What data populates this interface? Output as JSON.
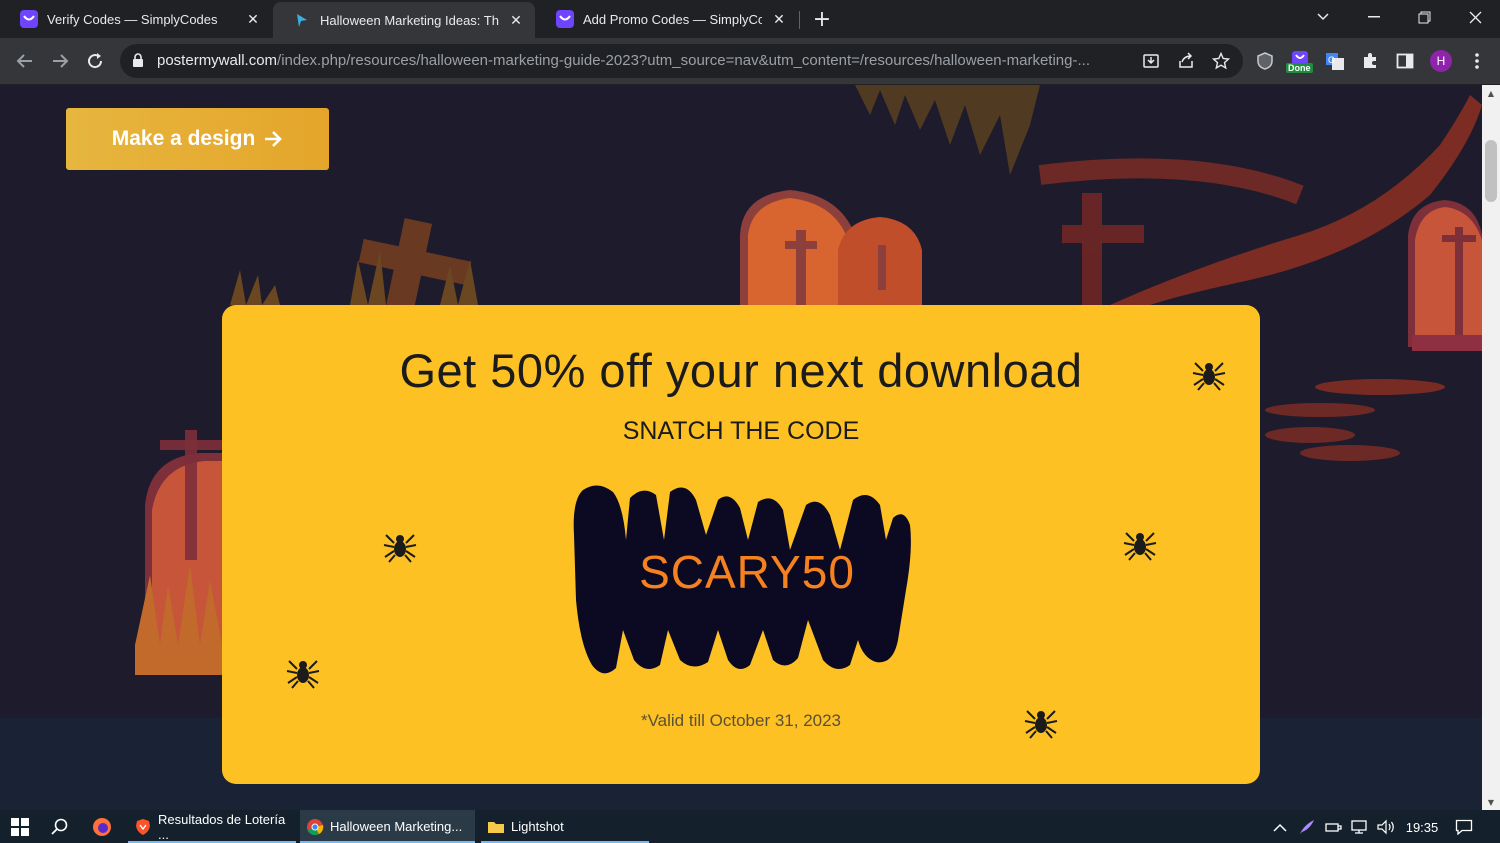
{
  "browser": {
    "tabs": [
      {
        "title": "Verify Codes — SimplyCodes",
        "active": false,
        "icon": "simplycodes-icon"
      },
      {
        "title": "Halloween Marketing Ideas: The",
        "active": true,
        "icon": "postermywall-icon"
      },
      {
        "title": "Add Promo Codes — SimplyCod",
        "active": false,
        "icon": "simplycodes-icon"
      }
    ],
    "url_host": "postermywall.com",
    "url_path": "/index.php/resources/halloween-marketing-guide-2023?utm_source=nav&utm_content=/resources/halloween-marketing-...",
    "extension_badge": "Done",
    "profile_initial": "H"
  },
  "page": {
    "cta_label": "Make a design",
    "promo": {
      "title": "Get 50% off your next download",
      "subtitle": "SNATCH THE CODE",
      "code": "SCARY50",
      "validity": "*Valid till October 31, 2023"
    }
  },
  "taskbar": {
    "apps": [
      {
        "label": "Resultados de Lotería ...",
        "icon": "brave-icon",
        "active": false
      },
      {
        "label": "Halloween Marketing...",
        "icon": "chrome-icon",
        "active": true
      },
      {
        "label": "Lightshot",
        "icon": "folder-icon",
        "active": false
      }
    ],
    "time": "19:35"
  },
  "colors": {
    "promo_bg": "#fec124",
    "code_color": "#f5821f",
    "cta_bg": "#e6b03a",
    "page_bg": "#1d1b2c"
  }
}
